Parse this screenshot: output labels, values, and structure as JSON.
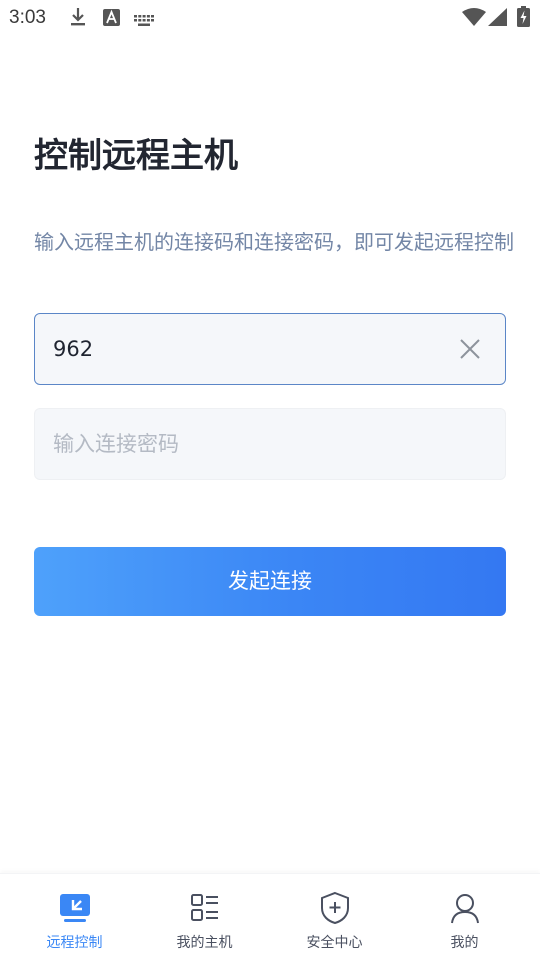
{
  "status_bar": {
    "time": "3:03",
    "icons": [
      "download-icon",
      "font-a-icon",
      "keyboard-icon",
      "wifi-icon",
      "signal-icon",
      "battery-charging-icon"
    ]
  },
  "page": {
    "title": "控制远程主机",
    "description": "输入远程主机的连接码和连接密码，即可发起远程控制"
  },
  "form": {
    "code_value": "962",
    "password_placeholder": "输入连接密码",
    "connect_label": "发起连接"
  },
  "nav": {
    "items": [
      {
        "label": "远程控制",
        "icon": "remote-desktop-icon",
        "active": true
      },
      {
        "label": "我的主机",
        "icon": "host-list-icon",
        "active": false
      },
      {
        "label": "安全中心",
        "icon": "shield-plus-icon",
        "active": false
      },
      {
        "label": "我的",
        "icon": "user-icon",
        "active": false
      }
    ]
  },
  "colors": {
    "accent": "#3a87f5",
    "title": "#222631",
    "description": "#7386a6",
    "field_bg": "#f5f7fa",
    "field_focus_border": "#5b86c7"
  }
}
